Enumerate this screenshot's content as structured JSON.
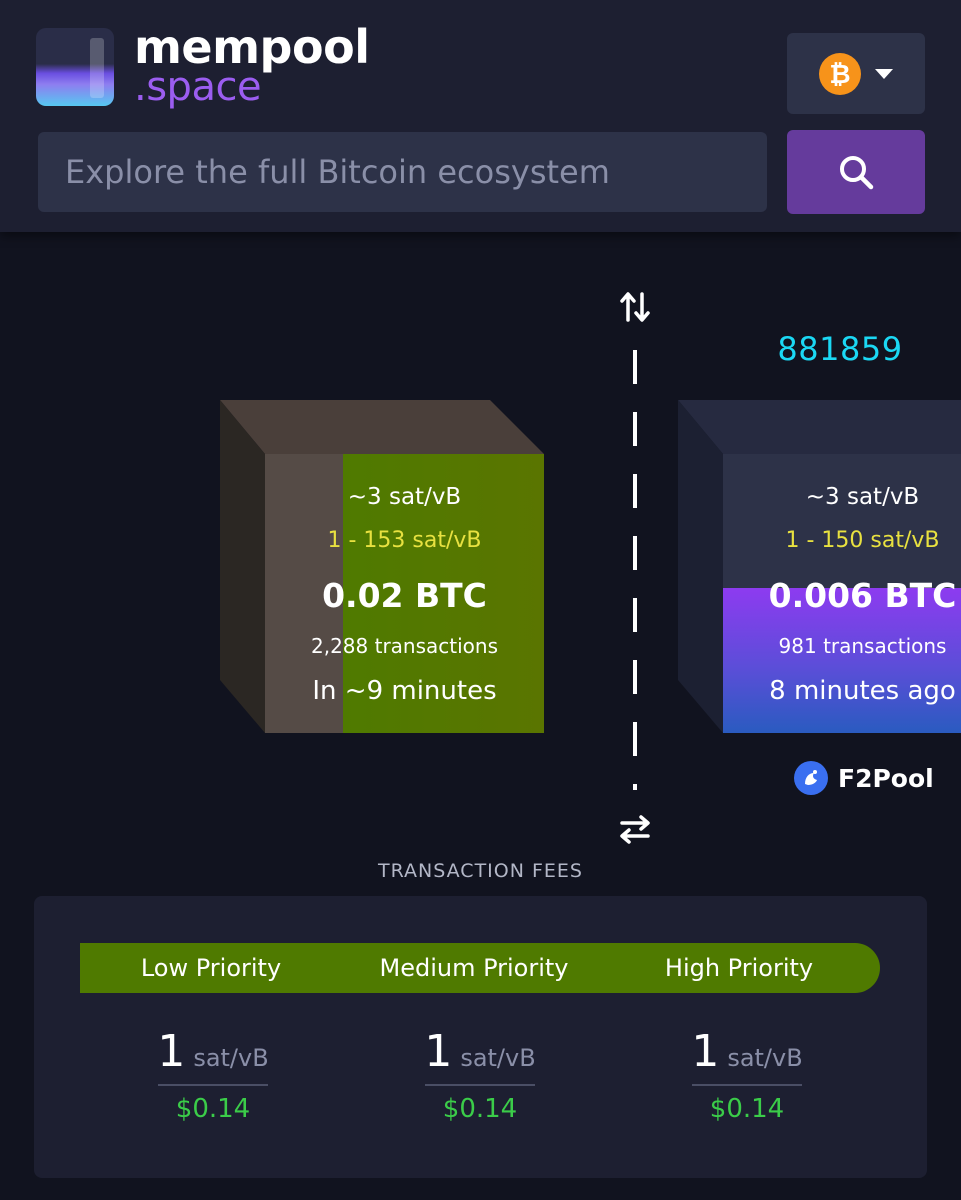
{
  "header": {
    "logo": {
      "line1": "mempool",
      "line2": ".space"
    },
    "network": {
      "icon": "bitcoin-icon",
      "symbol": "₿"
    },
    "search": {
      "placeholder": "Explore the full Bitcoin ecosystem",
      "button_icon": "search-icon"
    }
  },
  "blocks": {
    "pending": {
      "median_fee": "~3 sat/vB",
      "fee_range": "1 - 153 sat/vB",
      "total": "0.02 BTC",
      "tx_count": "2,288 transactions",
      "eta": "In ~9 minutes",
      "fill_fraction": 0.72,
      "color": "#4f7a00"
    },
    "mined": {
      "height": "881859",
      "median_fee": "~3 sat/vB",
      "fee_range": "1 - 150 sat/vB",
      "total": "0.006 BTC",
      "tx_count": "981 transactions",
      "age": "8 minutes ago",
      "fill_fraction": 0.52,
      "pool": "F2Pool",
      "color": "#7e3fe8"
    }
  },
  "fees": {
    "title": "TRANSACTION FEES",
    "priorities": [
      {
        "label": "Low Priority",
        "value": "1",
        "unit": "sat/vB",
        "usd": "$0.14"
      },
      {
        "label": "Medium Priority",
        "value": "1",
        "unit": "sat/vB",
        "usd": "$0.14"
      },
      {
        "label": "High Priority",
        "value": "1",
        "unit": "sat/vB",
        "usd": "$0.14"
      }
    ]
  }
}
